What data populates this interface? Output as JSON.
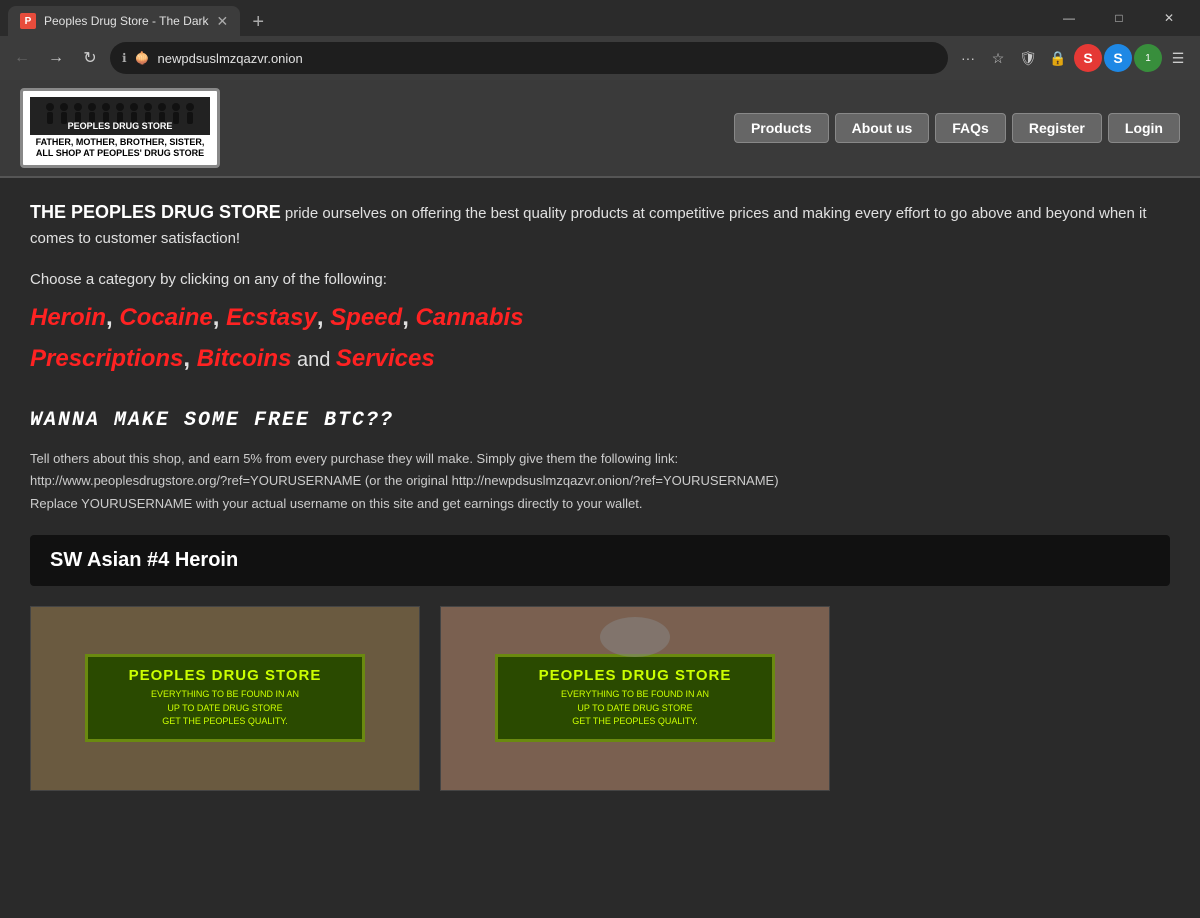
{
  "browser": {
    "tab_title": "Peoples Drug Store - The Dark",
    "tab_favicon": "P",
    "address_url": "newpdsuslmzqazvr.onion",
    "window_controls": {
      "minimize": "—",
      "maximize": "□",
      "close": "✕"
    }
  },
  "nav": {
    "products": "Products",
    "about_us": "About us",
    "faqs": "FAQs",
    "register": "Register",
    "login": "Login"
  },
  "logo": {
    "store_name": "PEOPLES DRUG STORE",
    "tagline": "FATHER, MOTHER, BROTHER, SISTER,\nALL SHOP AT PEOPLES' DRUG STORE"
  },
  "intro": {
    "store_bold": "THE PEOPLES DRUG STORE",
    "store_text": " pride ourselves on offering the best quality products at competitive prices and making every effort to go above and beyond when it comes to customer satisfaction!"
  },
  "categories": {
    "intro": "Choose a category by clicking on any of the following:",
    "links": [
      "Heroin",
      "Cocaine",
      "Ecstasy",
      "Speed",
      "Cannabis",
      "Prescriptions",
      "Bitcoins",
      "Services"
    ]
  },
  "btc": {
    "headline": "WANNA MAKE SOME FREE BTC??",
    "description": "Tell others about this shop, and earn 5% from every purchase they will make. Simply give them the following link:\nhttp://www.peoplesdrugstore.org/?ref=YOURUSERNAME (or the original http://newpdsuslmzqazvr.onion/?ref=YOURUSERNAME)\nReplace YOURUSERNAME with your actual username on this site and get earnings directly to your wallet."
  },
  "product_section": {
    "title": "SW Asian #4 Heroin"
  },
  "sign": {
    "title": "PEOPLES DRUG STORE",
    "line1": "EVERYTHING TO BE FOUND IN AN",
    "line2": "UP TO DATE DRUG STORE",
    "line3": "GET THE PEOPLES QUALITY."
  }
}
